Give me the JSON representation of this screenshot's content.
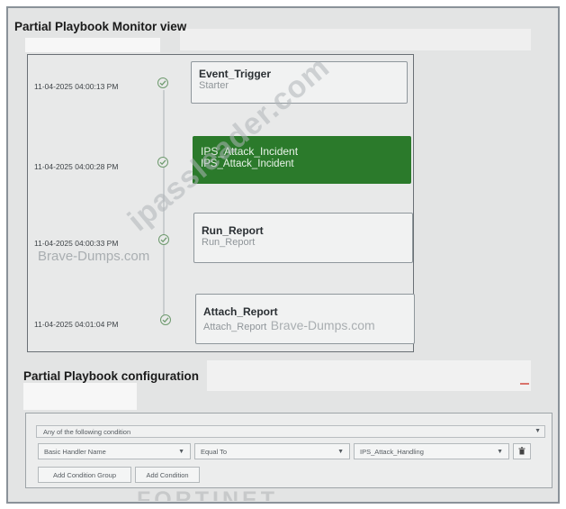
{
  "monitor": {
    "title": "Partial Playbook Monitor view",
    "tasks": [
      {
        "timestamp": "11-04-2025 04:00:13 PM",
        "name": "Event_Trigger",
        "subtitle": "Starter",
        "active": false
      },
      {
        "timestamp": "11-04-2025 04:00:28 PM",
        "name": "IPS_Attack_Incident",
        "subtitle": "IPS_Attack_Incident",
        "active": true
      },
      {
        "timestamp": "11-04-2025 04:00:33 PM",
        "name": "Run_Report",
        "subtitle": "Run_Report",
        "active": false
      },
      {
        "timestamp": "11-04-2025 04:01:04 PM",
        "name": "Attach_Report",
        "subtitle": "Attach_Report",
        "active": false
      }
    ],
    "status_icon": "check-circle-icon"
  },
  "configuration": {
    "title": "Partial Playbook configuration",
    "condition_mode": "Any of the following condition",
    "condition": {
      "field": "Basic Handler Name",
      "operator": "Equal To",
      "value": "IPS_Attack_Handling"
    },
    "delete_icon": "trash-icon",
    "add_condition_group_label": "Add Condition Group",
    "add_condition_label": "Add Condition"
  },
  "watermarks": {
    "brave_dumps": "Brave-Dumps.com",
    "ipassleader": "ipassleader.com",
    "fortinet": "FORTINET"
  },
  "colors": {
    "active_node": "#2b7a2b",
    "status_check": "#6e9a6e",
    "background": "#e3e4e4"
  }
}
